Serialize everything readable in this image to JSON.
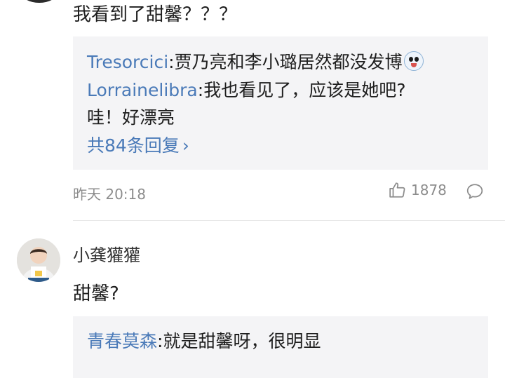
{
  "comment1": {
    "text": "我看到了甜馨？？？",
    "replies": [
      {
        "user": "Tresorcici",
        "text": ":贾乃亮和李小璐居然都没发博"
      },
      {
        "user": "Lorrainelibra",
        "text": ":我也看见了，应该是她吧?"
      }
    ],
    "reply_continuation": "哇！好漂亮",
    "more_replies": "共84条回复",
    "more_chevron": "›",
    "time": "昨天 20:18",
    "likes": "1878",
    "icons": {
      "emoji": "surprised-face-emoji",
      "like": "thumbs-up-icon",
      "comment": "comment-bubble-icon"
    }
  },
  "comment2": {
    "username": "小龚獾獾",
    "text": "甜馨?",
    "replies": [
      {
        "user": "青春莫森",
        "text": ":就是甜馨呀，很明显"
      }
    ]
  },
  "colors": {
    "link": "#4a7ab8",
    "reply_bg": "#f4f4f6",
    "meta": "#8c8c8c"
  }
}
